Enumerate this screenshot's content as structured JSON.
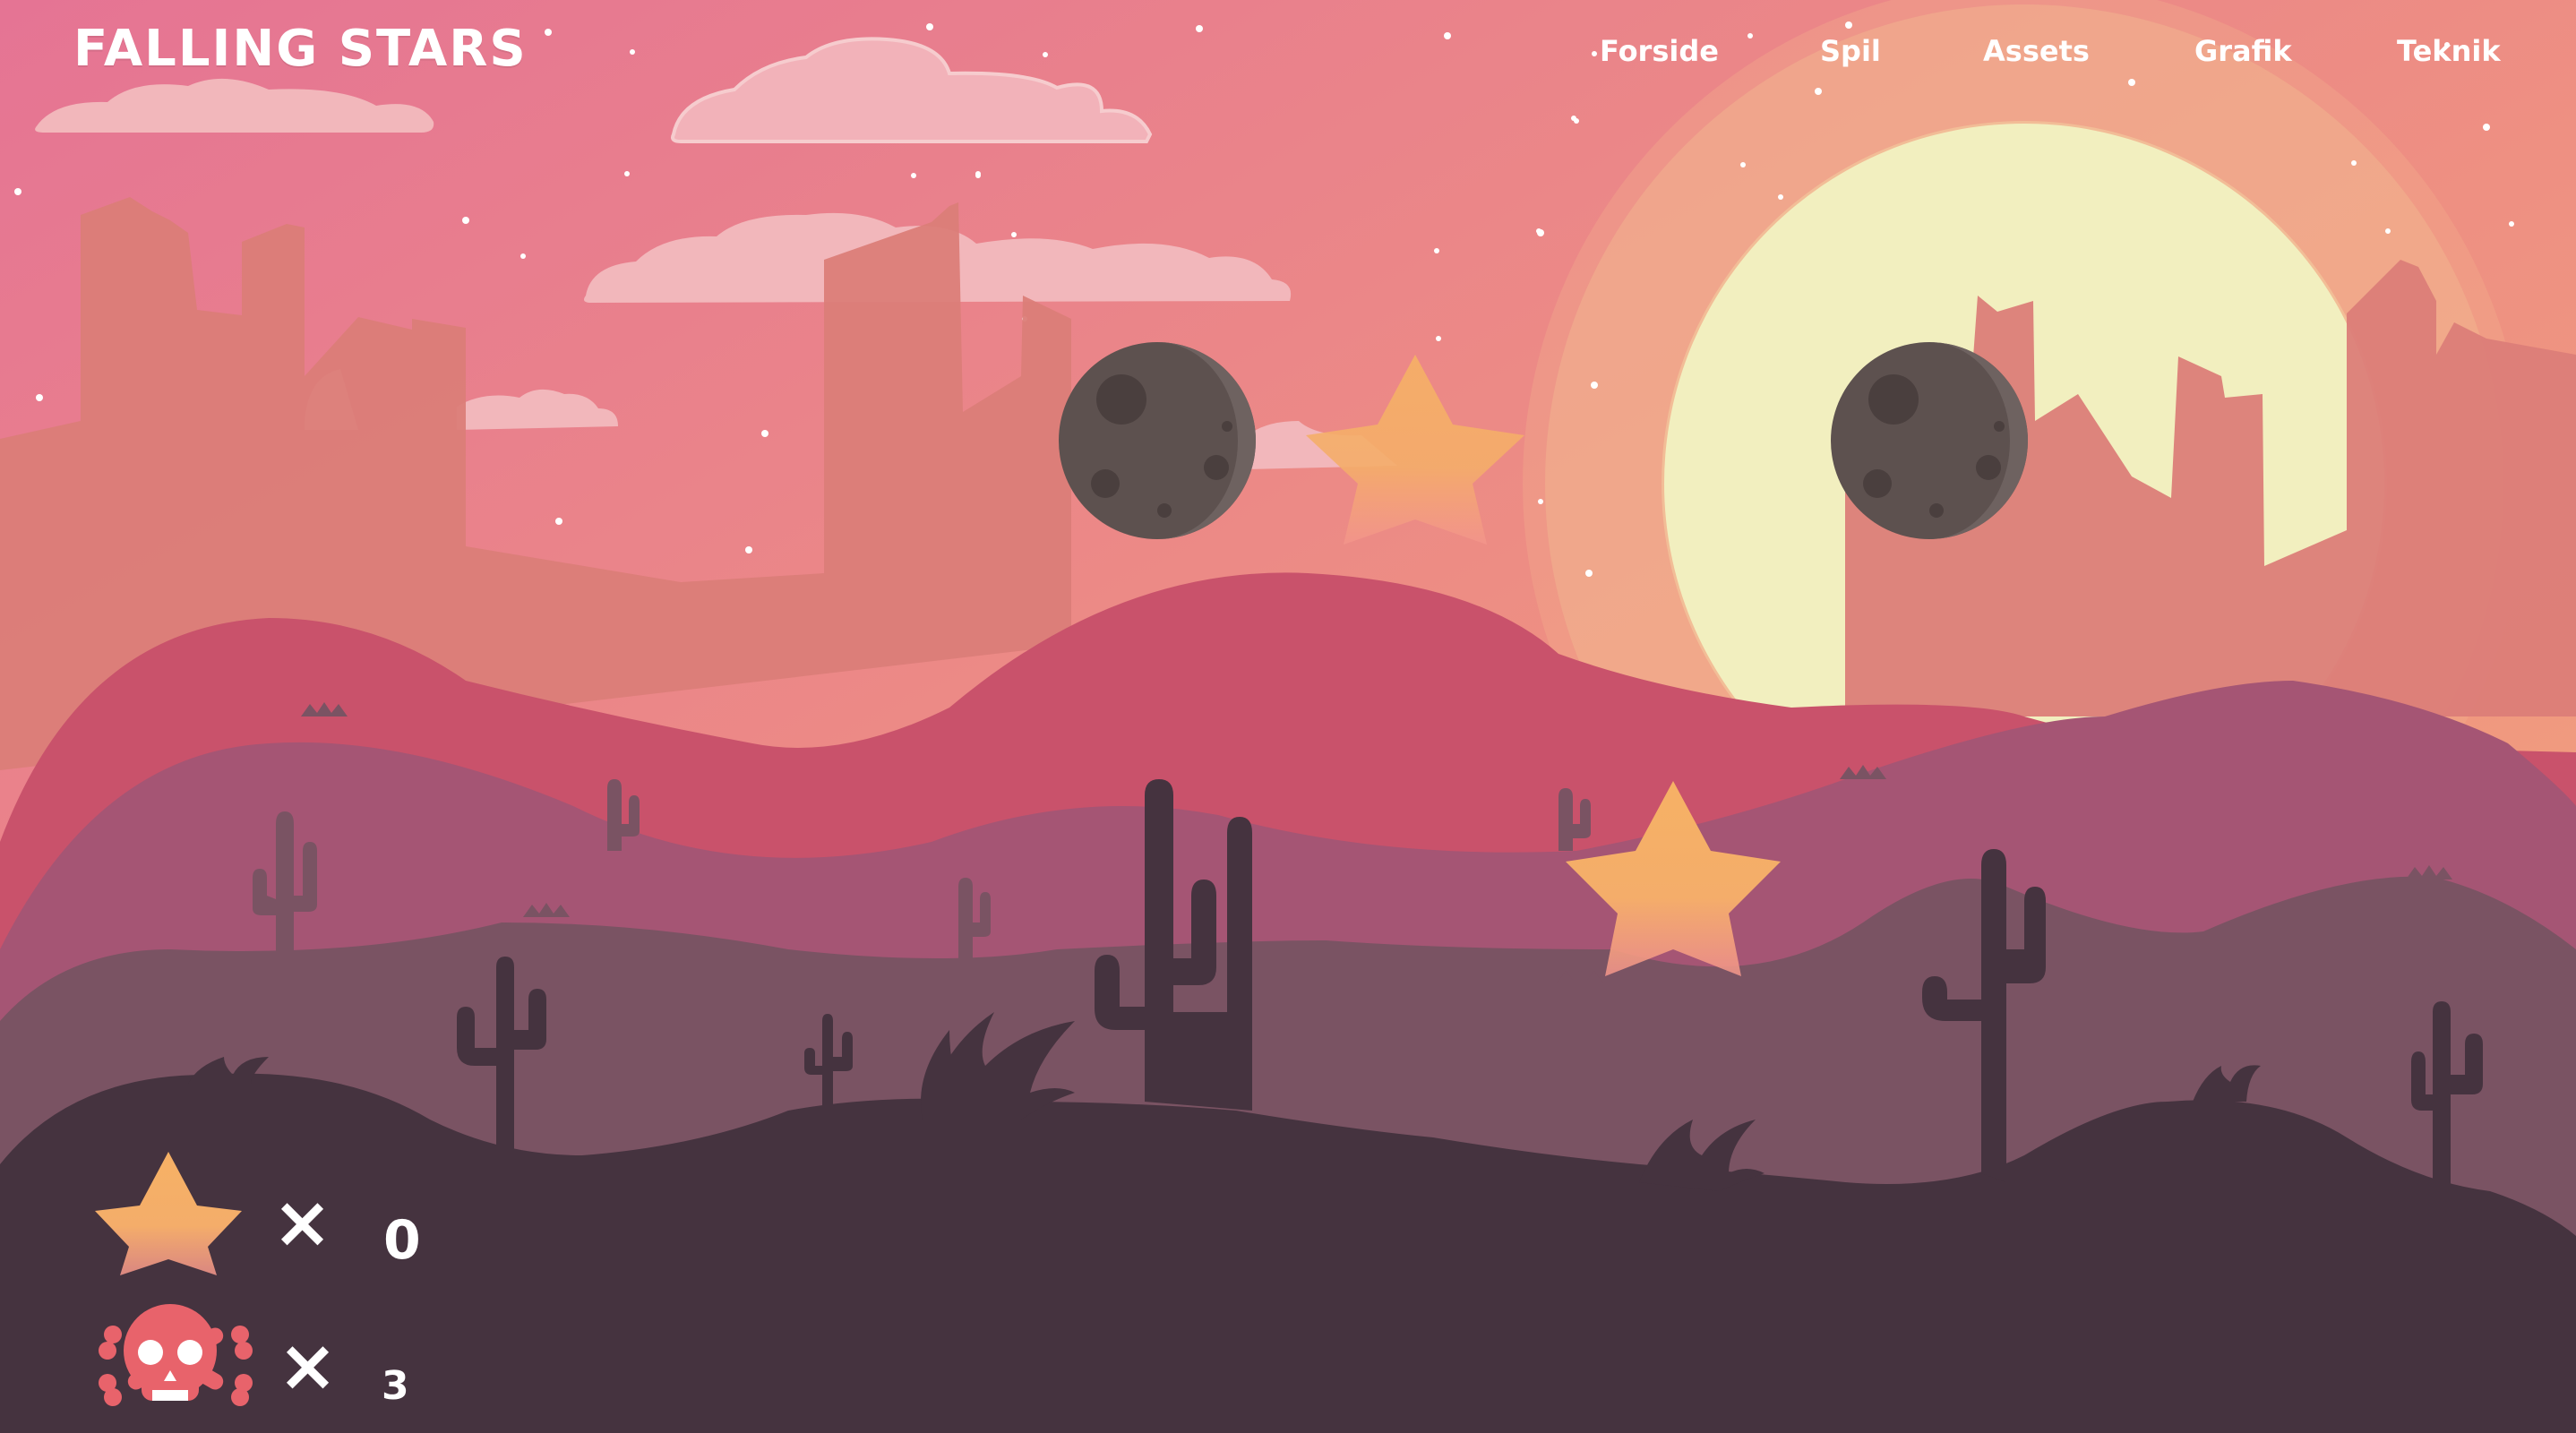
{
  "header": {
    "logo": "FALLING STARS",
    "nav": [
      "Forside",
      "Spil",
      "Assets",
      "Grafik",
      "Teknik"
    ]
  },
  "hud": {
    "stars": {
      "icon": "star-icon",
      "multiplier": "×",
      "count": "0"
    },
    "lives": {
      "icon": "skull-crossbones-icon",
      "multiplier": "×",
      "count": "3"
    }
  },
  "colors": {
    "sky_top": "#e57494",
    "sky_bottom": "#f2a57b",
    "sun": "#f2efbf",
    "star_top": "#f6b165",
    "star_bottom": "#f19a8a",
    "hill_red": "#c9526b",
    "hill_purple": "#a55574",
    "hill_mauve": "#7a5363",
    "ground": "#45333f",
    "skull": "#e8636b"
  }
}
